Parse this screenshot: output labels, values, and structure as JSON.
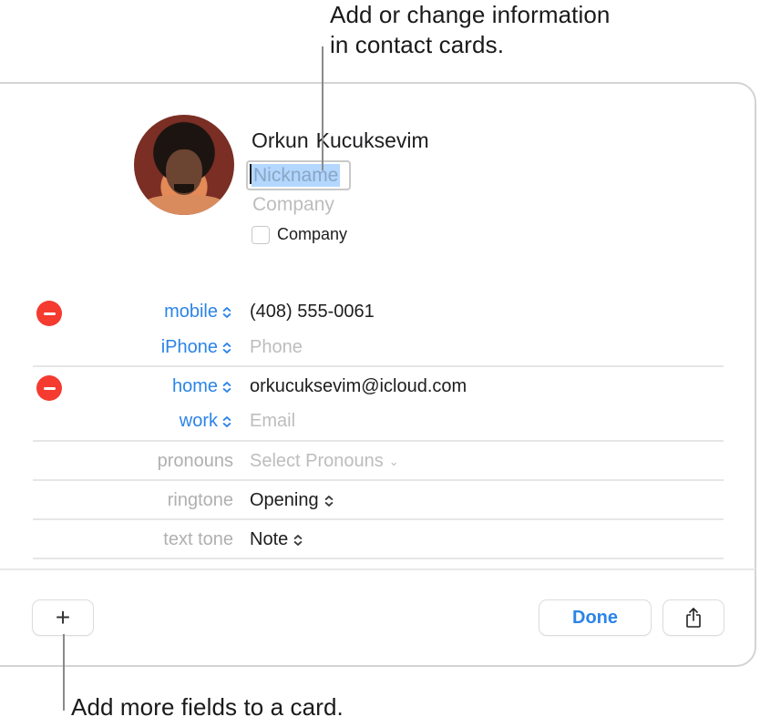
{
  "callouts": {
    "top_line1": "Add or change information",
    "top_line2": "in contact cards.",
    "bottom": "Add more fields to a card."
  },
  "contact": {
    "first_name": "Orkun",
    "last_name": "Kucuksevim",
    "nickname_placeholder": "Nickname",
    "company_placeholder": "Company",
    "company_checkbox_label": "Company",
    "company_checkbox_checked": false
  },
  "fields": {
    "phone": [
      {
        "label": "mobile",
        "value": "(408) 555-0061",
        "placeholder": false,
        "removable": true
      },
      {
        "label": "iPhone",
        "value": "Phone",
        "placeholder": true,
        "removable": false
      }
    ],
    "email": [
      {
        "label": "home",
        "value": "orkucuksevim@icloud.com",
        "placeholder": false,
        "removable": true
      },
      {
        "label": "work",
        "value": "Email",
        "placeholder": true,
        "removable": false
      }
    ],
    "pronouns": {
      "label": "pronouns",
      "value": "Select Pronouns"
    },
    "ringtone": {
      "label": "ringtone",
      "value": "Opening"
    },
    "text_tone": {
      "label": "text tone",
      "value": "Note"
    }
  },
  "footer": {
    "add_label": "+",
    "done_label": "Done",
    "share_icon": "share-icon"
  },
  "colors": {
    "accent": "#2b84e8",
    "remove": "#f53a30",
    "selection": "#b3d7ff",
    "placeholder": "#bdbdbd"
  }
}
